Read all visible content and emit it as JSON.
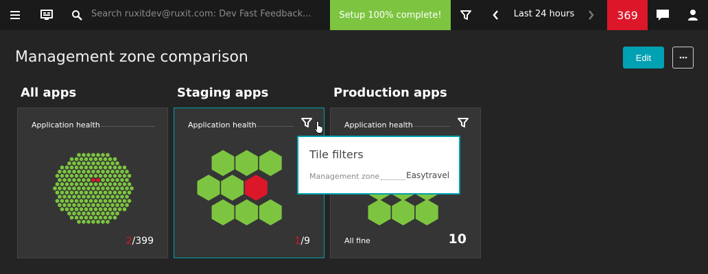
{
  "topbar": {
    "search_placeholder": "Search ruxitdev@ruxit.com: Dev Fast Feedback...",
    "setup_label": "Setup 100% complete!",
    "timeframe": "Last 24 hours",
    "problem_count": "369"
  },
  "page": {
    "title": "Management zone comparison",
    "edit_label": "Edit"
  },
  "columns": [
    {
      "title": "All apps",
      "tile_label": "Application health",
      "bad": "2",
      "total": "/399"
    },
    {
      "title": "Staging apps",
      "tile_label": "Application health",
      "bad": "1",
      "total": "/9"
    },
    {
      "title": "Production apps",
      "tile_label": "Application health",
      "status": "All fine",
      "count": "10"
    }
  ],
  "popup": {
    "title": "Tile filters",
    "key": "Management zone",
    "value": "Easytravel"
  },
  "colors": {
    "healthy": "#7dc540",
    "problem": "#dc172a",
    "accent": "#00a1b2",
    "setup": "#7dc540"
  },
  "icons": [
    "menu-icon",
    "dashboard-icon",
    "search-icon",
    "filter-icon",
    "chevron-left-icon",
    "chevron-right-icon",
    "chat-icon",
    "user-icon",
    "more-icon",
    "hand-cursor-icon"
  ]
}
